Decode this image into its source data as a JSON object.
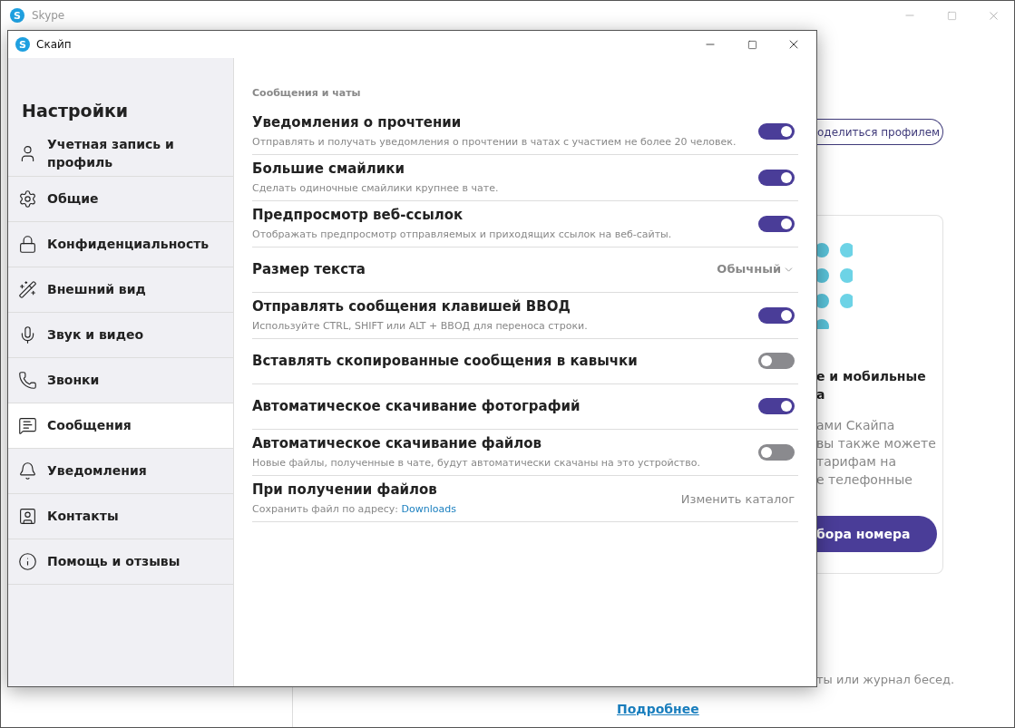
{
  "background_window": {
    "logo": "S",
    "title": "Skype",
    "share_button": "оделиться профилем",
    "card": {
      "heading_lines": [
        "е и мобильные",
        "а"
      ],
      "body_lines": [
        "ами Скайпа",
        "вы также можете",
        "тарифам на",
        "е телефонные"
      ],
      "button": "бора номера"
    },
    "footer_text": "ты или журнал бесед.",
    "learn_more_link": "Подробнее"
  },
  "dialog": {
    "logo": "S",
    "title": "Скайп",
    "sidebar": {
      "heading": "Настройки",
      "items": [
        {
          "label": "Учетная запись и профиль",
          "selected": false
        },
        {
          "label": "Общие",
          "selected": false
        },
        {
          "label": "Конфиденциальность",
          "selected": false
        },
        {
          "label": "Внешний вид",
          "selected": false
        },
        {
          "label": "Звук и видео",
          "selected": false
        },
        {
          "label": "Звонки",
          "selected": false
        },
        {
          "label": "Сообщения",
          "selected": true
        },
        {
          "label": "Уведомления",
          "selected": false
        },
        {
          "label": "Контакты",
          "selected": false
        },
        {
          "label": "Помощь и отзывы",
          "selected": false
        }
      ]
    },
    "section_title": "Сообщения и чаты",
    "settings": [
      {
        "kind": "toggle",
        "title": "Уведомления о прочтении",
        "description": "Отправлять и получать уведомления о прочтении в чатах с участием не более 20 человек.",
        "on": true
      },
      {
        "kind": "toggle",
        "title": "Большие смайлики",
        "description": "Сделать одиночные смайлики крупнее в чате.",
        "on": true
      },
      {
        "kind": "toggle",
        "title": "Предпросмотр веб-ссылок",
        "description": "Отображать предпросмотр отправляемых и приходящих ссылок на веб-сайты.",
        "on": true
      },
      {
        "kind": "dropdown",
        "title": "Размер текста",
        "value": "Обычный"
      },
      {
        "kind": "toggle",
        "title": "Отправлять сообщения клавишей ВВОД",
        "description": "Используйте CTRL, SHIFT или ALT + ВВОД для переноса строки.",
        "on": true
      },
      {
        "kind": "toggle",
        "title": "Вставлять скопированные сообщения в кавычки",
        "on": false
      },
      {
        "kind": "toggle",
        "title": "Автоматическое скачивание фотографий",
        "on": true
      },
      {
        "kind": "toggle",
        "title": "Автоматическое скачивание файлов",
        "description": "Новые файлы, полученные в чате, будут автоматически скачаны на это устройство.",
        "on": false
      },
      {
        "kind": "folder",
        "title": "При получении файлов",
        "description": "Сохранить файл по адресу:",
        "link": "Downloads",
        "action": "Изменить каталог"
      }
    ]
  }
}
